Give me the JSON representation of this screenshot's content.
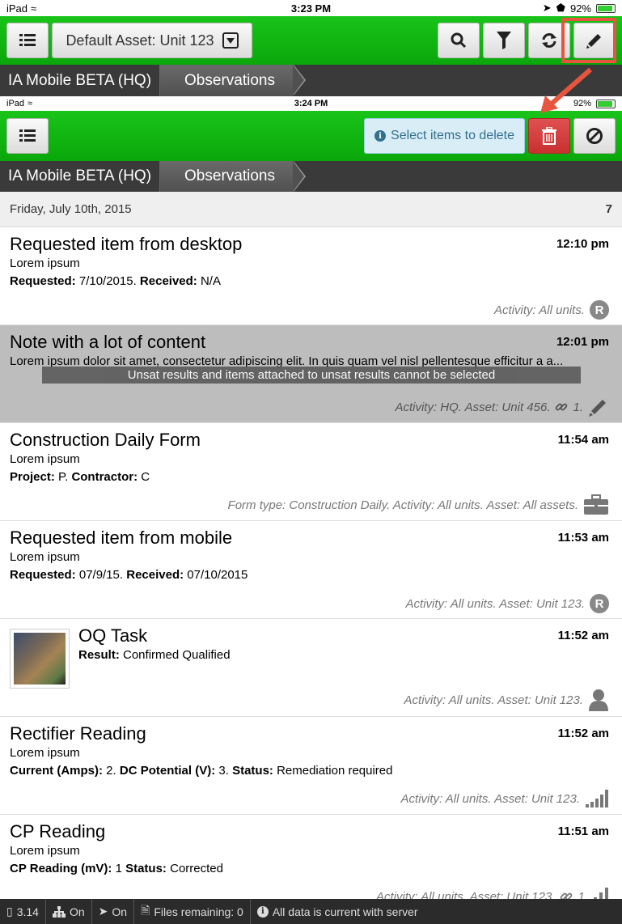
{
  "status_bar_1": {
    "device": "iPad",
    "time": "3:23 PM",
    "battery": "92%"
  },
  "toolbar_1": {
    "asset_label": "Default Asset: Unit 123"
  },
  "breadcrumb_1": {
    "home": "IA Mobile BETA (HQ)",
    "current": "Observations"
  },
  "status_bar_2": {
    "device": "iPad",
    "time": "3:24 PM",
    "battery": "92%"
  },
  "toolbar_2": {
    "delete_hint": "Select items to delete"
  },
  "breadcrumb_2": {
    "home": "IA Mobile BETA (HQ)",
    "current": "Observations"
  },
  "list": {
    "date": "Friday, July 10th, 2015",
    "count": "7",
    "items": [
      {
        "title": "Requested item from desktop",
        "time": "12:10 pm",
        "subtitle": "Lorem ipsum",
        "detail": [
          {
            "label": "Requested:",
            "value": " 7/10/2015. "
          },
          {
            "label": "Received:",
            "value": " N/A"
          }
        ],
        "footer": "Activity: All units.",
        "badge": "R"
      },
      {
        "title": "Note with a lot of content",
        "time": "12:01 pm",
        "subtitle": "Lorem ipsum dolor sit amet, consectetur adipiscing elit. In quis quam vel nisl pellentesque efficitur a a...",
        "banner": "Unsat results and items attached to unsat results cannot be selected",
        "footer": "Activity: HQ. Asset: Unit 456.",
        "attach_count": "1."
      },
      {
        "title": "Construction Daily Form",
        "time": "11:54 am",
        "subtitle": "Lorem ipsum",
        "detail": [
          {
            "label": "Project:",
            "value": " P. "
          },
          {
            "label": "Contractor:",
            "value": " C"
          }
        ],
        "footer": "Form type: Construction Daily. Activity: All units. Asset: All assets."
      },
      {
        "title": "Requested item from mobile",
        "time": "11:53 am",
        "subtitle": "Lorem ipsum",
        "detail": [
          {
            "label": "Requested:",
            "value": " 07/9/15. "
          },
          {
            "label": "Received:",
            "value": " 07/10/2015"
          }
        ],
        "footer": "Activity: All units. Asset: Unit 123.",
        "badge": "R"
      },
      {
        "title": "OQ Task",
        "time": "11:52 am",
        "detail": [
          {
            "label": "Result:",
            "value": " Confirmed Qualified"
          }
        ],
        "footer": "Activity: All units. Asset: Unit 123."
      },
      {
        "title": "Rectifier Reading",
        "time": "11:52 am",
        "subtitle": "Lorem ipsum",
        "detail": [
          {
            "label": "Current (Amps):",
            "value": " 2. "
          },
          {
            "label": "DC Potential (V):",
            "value": " 3. "
          },
          {
            "label": "Status:",
            "value": " Remediation required"
          }
        ],
        "footer": "Activity: All units. Asset: Unit 123."
      },
      {
        "title": "CP Reading",
        "time": "11:51 am",
        "subtitle": "Lorem ipsum",
        "detail": [
          {
            "label": "CP Reading (mV):",
            "value": " 1 "
          },
          {
            "label": "Status:",
            "value": " Corrected"
          }
        ],
        "footer": "Activity: All units. Asset: Unit 123.",
        "attach_count": "1."
      }
    ]
  },
  "bottom_bar": {
    "version": "3.14",
    "network": "On",
    "location": "On",
    "files": "Files remaining: 0",
    "sync": "All data is current with server"
  },
  "colors": {
    "toolbar_green": "#12b812",
    "danger": "#d9534f",
    "highlight": "#e8553f",
    "info_bg": "#d9edf7"
  }
}
